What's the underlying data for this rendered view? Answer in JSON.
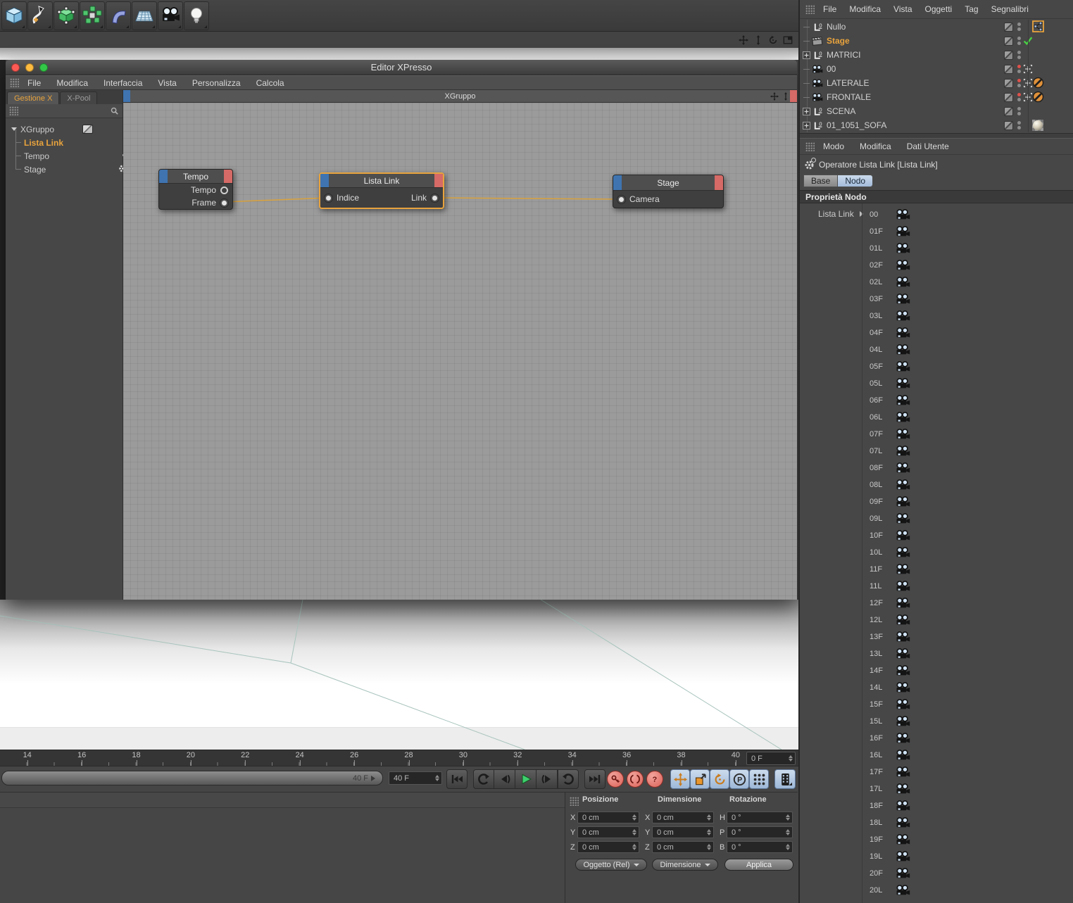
{
  "colors": {
    "accent_orange": "#e8a33d",
    "wire": "#d9a23c",
    "node_blue": "#3f74b0",
    "node_red": "#d56a66",
    "tab_blue": "#aec5e2",
    "play_green": "#3ecf6e",
    "record_red": "#e98b84",
    "canvas_gray": "#9b9b9b"
  },
  "main_toolbar": {
    "icons": [
      "add-cube-icon",
      "draw-spline-icon",
      "make-editable-icon",
      "array-object-icon",
      "bend-deformer-icon",
      "floor-object-icon",
      "camera-object-icon",
      "light-object-icon"
    ]
  },
  "corner_icons": [
    "move-panel-icon",
    "dock-panel-icon",
    "rotate-panel-icon",
    "layout-panel-icon"
  ],
  "xpresso_window": {
    "title": "Editor XPresso",
    "menu_items": [
      "File",
      "Modifica",
      "Interfaccia",
      "Vista",
      "Personalizza",
      "Calcola"
    ],
    "tabs": [
      {
        "label": "Gestione X",
        "active": true
      },
      {
        "label": "X-Pool",
        "active": false
      }
    ],
    "tree": {
      "root_label": "XGruppo",
      "items": [
        {
          "label": "Lista Link",
          "selected": true
        },
        {
          "label": "Tempo",
          "selected": false
        },
        {
          "label": "Stage",
          "selected": false
        }
      ]
    },
    "canvas_title": "XGruppo",
    "nodes": {
      "tempo": {
        "title": "Tempo",
        "ports": [
          {
            "label": "Tempo"
          },
          {
            "label": "Frame"
          }
        ]
      },
      "lista_link": {
        "title": "Lista Link",
        "input": "Indice",
        "output": "Link"
      },
      "stage": {
        "title": "Stage",
        "input": "Camera"
      }
    }
  },
  "object_manager": {
    "menu_items": [
      "File",
      "Modifica",
      "Vista",
      "Oggetti",
      "Tag",
      "Segnalibri"
    ],
    "objects": [
      {
        "name": "Nullo",
        "is_null": true,
        "leaf": true,
        "tag_xpresso": true
      },
      {
        "name": "Stage",
        "is_stage": true,
        "leaf": true,
        "selected": true,
        "tag_check": true
      },
      {
        "name": "MATRICI",
        "is_null": true,
        "expand": true
      },
      {
        "name": "00",
        "is_cam": true,
        "leaf": true,
        "red": true,
        "target": true
      },
      {
        "name": "LATERALE",
        "is_cam": true,
        "leaf": true,
        "red": true,
        "target": true,
        "tag_protection": true
      },
      {
        "name": "FRONTALE",
        "is_cam": true,
        "leaf": true,
        "red": true,
        "target": true,
        "tag_protection": true
      },
      {
        "name": "SCENA",
        "is_null": true,
        "expand": true
      },
      {
        "name": "01_1051_SOFA",
        "is_null": true,
        "expand": true,
        "tag_material": true
      }
    ]
  },
  "attribute_manager": {
    "menu_items": [
      "Modo",
      "Modifica",
      "Dati Utente"
    ],
    "title": "Operatore Lista Link [Lista Link]",
    "tabs": [
      {
        "label": "Base",
        "active": false
      },
      {
        "label": "Nodo",
        "active": true
      }
    ],
    "section_title": "Proprietà Nodo",
    "list_label": "Lista Link",
    "links": [
      "00",
      "01F",
      "01L",
      "02F",
      "02L",
      "03F",
      "03L",
      "04F",
      "04L",
      "05F",
      "05L",
      "06F",
      "06L",
      "07F",
      "07L",
      "08F",
      "08L",
      "09F",
      "09L",
      "10F",
      "10L",
      "11F",
      "11L",
      "12F",
      "12L",
      "13F",
      "13L",
      "14F",
      "14L",
      "15F",
      "15L",
      "16F",
      "16L",
      "17F",
      "17L",
      "18F",
      "18L",
      "19F",
      "19L",
      "20F",
      "20L"
    ]
  },
  "timeline": {
    "ticks": [
      "14",
      "16",
      "18",
      "20",
      "22",
      "24",
      "26",
      "28",
      "30",
      "32",
      "34",
      "36",
      "38",
      "40"
    ],
    "current_frame": "0 F",
    "range_label": "40 F",
    "end_frame": "40 F",
    "transport_icons": [
      "goto-start-icon",
      "prev-key-icon",
      "prev-frame-icon",
      "play-icon",
      "next-frame-icon",
      "next-key-icon",
      "goto-end-icon",
      "record-key-icon",
      "autokey-icon",
      "record-help-icon",
      "key-position-icon",
      "key-scale-icon",
      "key-rotation-icon",
      "key-parameter-icon",
      "key-pla-icon",
      "timeline-icon"
    ]
  },
  "coordinates": {
    "position": {
      "title": "Posizione",
      "rows": [
        {
          "axis": "X",
          "value": "0 cm"
        },
        {
          "axis": "Y",
          "value": "0 cm"
        },
        {
          "axis": "Z",
          "value": "0 cm"
        }
      ],
      "button": "Oggetto (Rel)"
    },
    "size": {
      "title": "Dimensione",
      "rows": [
        {
          "axis": "X",
          "value": "0 cm"
        },
        {
          "axis": "Y",
          "value": "0 cm"
        },
        {
          "axis": "Z",
          "value": "0 cm"
        }
      ],
      "button": "Dimensione"
    },
    "rotation": {
      "title": "Rotazione",
      "rows": [
        {
          "axis": "H",
          "value": "0 °"
        },
        {
          "axis": "P",
          "value": "0 °"
        },
        {
          "axis": "B",
          "value": "0 °"
        }
      ],
      "button": "Applica"
    }
  }
}
